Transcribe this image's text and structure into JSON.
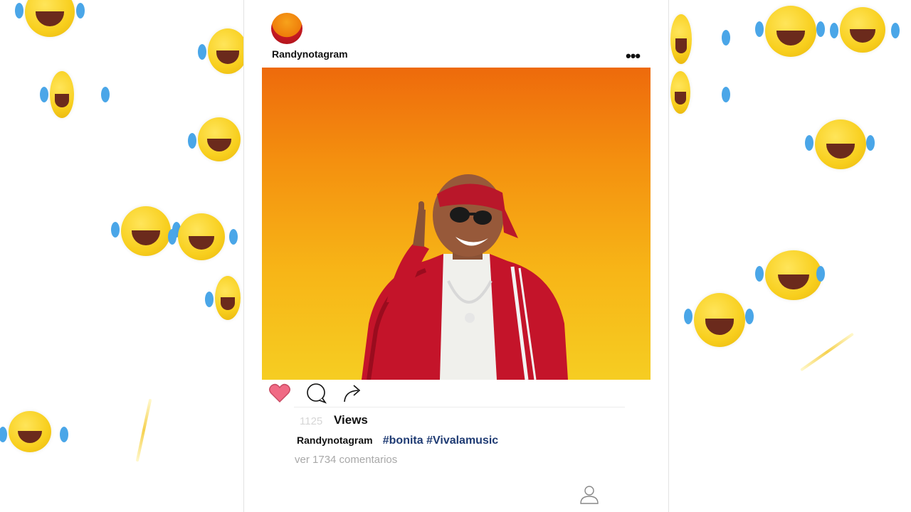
{
  "post": {
    "username": "Randynotagram",
    "more_label": "•••",
    "like_icon": "heart-icon",
    "comment_icon": "comment-icon",
    "share_icon": "share-icon",
    "views_count": "1125",
    "views_label": "Views",
    "caption_user": "Randynotagram",
    "hashtags": "#bonita #Vivalamusic",
    "comments_link": "ver 1734 comentarios",
    "profile_icon": "profile-icon"
  },
  "colors": {
    "like": "#f06a84",
    "hashtag": "#1f3b73",
    "photo_top": "#ee6a0c",
    "photo_bottom": "#f6cd22"
  }
}
